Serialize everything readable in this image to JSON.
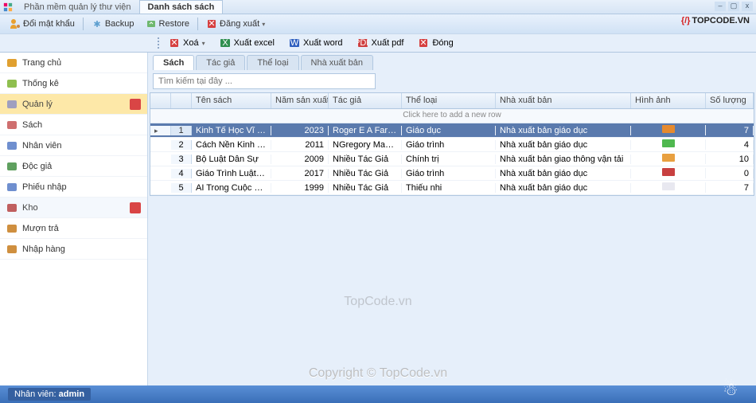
{
  "window": {
    "app_tab": "Phần mềm quản lý thư viện",
    "page_tab": "Danh sách sách"
  },
  "topbar": {
    "change_password": "Đổi mật khẩu",
    "backup": "Backup",
    "restore": "Restore",
    "logout": "Đăng xuất"
  },
  "brand": "TOPCODE.VN",
  "toolbar": {
    "delete": "Xoá",
    "export_excel": "Xuất excel",
    "export_word": "Xuất word",
    "export_pdf": "Xuất pdf",
    "close": "Đóng"
  },
  "sidebar": {
    "items": [
      {
        "label": "Trang chủ",
        "icon": "home",
        "color": "#e0a030"
      },
      {
        "label": "Thống kê",
        "icon": "chart",
        "color": "#8fbf4f"
      },
      {
        "label": "Quản lý",
        "icon": "manage",
        "color": "#9f9fbf",
        "group": true,
        "selected": true
      },
      {
        "label": "Sách",
        "icon": "book",
        "color": "#cf6f6f"
      },
      {
        "label": "Nhân viên",
        "icon": "user",
        "color": "#6f8fcf"
      },
      {
        "label": "Độc giả",
        "icon": "reader",
        "color": "#5fa05f"
      },
      {
        "label": "Phiếu nhập",
        "icon": "ticket",
        "color": "#6f8fcf"
      },
      {
        "label": "Kho",
        "icon": "warehouse",
        "color": "#c05f5f",
        "group": true
      },
      {
        "label": "Mượn trả",
        "icon": "borrow",
        "color": "#cf8f3f"
      },
      {
        "label": "Nhập hàng",
        "icon": "import",
        "color": "#cf8f3f"
      }
    ]
  },
  "tabs": [
    {
      "label": "Sách",
      "active": true
    },
    {
      "label": "Tác giả"
    },
    {
      "label": "Thể loại"
    },
    {
      "label": "Nhà xuất bản"
    }
  ],
  "search": {
    "placeholder": "Tìm kiếm tại đây ..."
  },
  "grid": {
    "headers": {
      "name": "Tên sách",
      "year": "Năm sản xuất",
      "author": "Tác giả",
      "genre": "Thể loại",
      "publisher": "Nhà xuất bản",
      "image": "Hình ảnh",
      "qty": "Số lượng"
    },
    "new_row_hint": "Click here to add a new row",
    "rows": [
      {
        "n": "1",
        "name": "Kinh Tế Học Vĩ Mô",
        "year": "2023",
        "author": "Roger E A Farmer",
        "genre": "Giáo dục",
        "publisher": "Nhà xuất bản giáo dục",
        "img_color": "#e68a2e",
        "qty": "7",
        "selected": true
      },
      {
        "n": "2",
        "name": "Cách Nền Kinh Tế...",
        "year": "2011",
        "author": "NGregory Mankiw",
        "genre": "Giáo trình",
        "publisher": "Nhà xuất bản giáo dục",
        "img_color": "#4fb84f",
        "qty": "4"
      },
      {
        "n": "3",
        "name": "Bộ Luật Dân Sự",
        "year": "2009",
        "author": "Nhiều Tác Giả",
        "genre": "Chính trị",
        "publisher": "Nhà xuất bản giao thông vận tải",
        "img_color": "#e8a040",
        "qty": "10"
      },
      {
        "n": "4",
        "name": "Giáo Trình Luật Hiế...",
        "year": "2017",
        "author": "Nhiều Tác Giả",
        "genre": "Giáo trình",
        "publisher": "Nhà xuất bản giáo dục",
        "img_color": "#c84040",
        "qty": "0"
      },
      {
        "n": "5",
        "name": "AI Trong Cuộc Các...",
        "year": "1999",
        "author": "Nhiều Tác Giả",
        "genre": "Thiếu nhi",
        "publisher": "Nhà xuất bản giáo dục",
        "img_color": "#e8e8f0",
        "qty": "7"
      }
    ]
  },
  "watermarks": {
    "w1": "TopCode.vn",
    "w2": "Copyright © TopCode.vn"
  },
  "statusbar": {
    "label": "Nhân viên:",
    "user": "admin"
  }
}
